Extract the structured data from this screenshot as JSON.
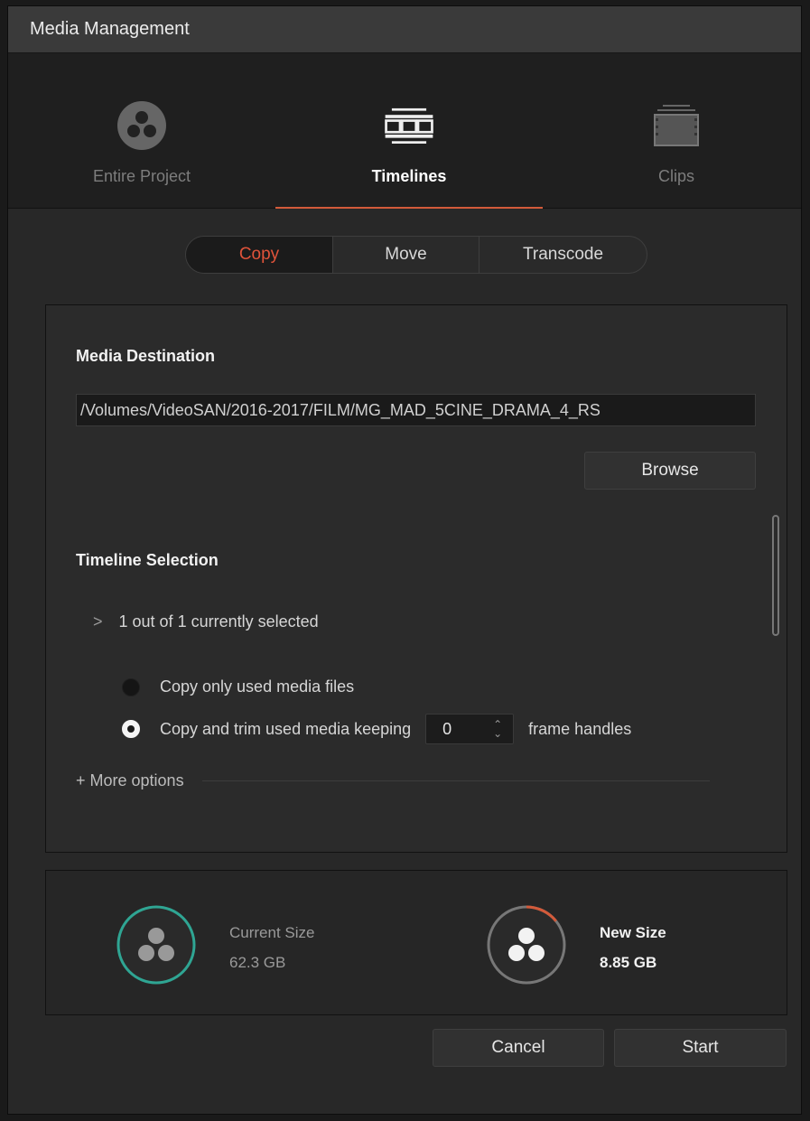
{
  "window": {
    "title": "Media Management"
  },
  "mode_tabs": [
    {
      "label": "Entire Project",
      "icon": "resolve-logo-icon",
      "active": false
    },
    {
      "label": "Timelines",
      "icon": "timeline-icon",
      "active": true
    },
    {
      "label": "Clips",
      "icon": "clip-film-icon",
      "active": false
    }
  ],
  "operation": {
    "options": [
      "Copy",
      "Move",
      "Transcode"
    ],
    "selected": "Copy"
  },
  "media_destination": {
    "title": "Media Destination",
    "path": "/Volumes/VideoSAN/2016-2017/FILM/MG_MAD_5CINE_DRAMA_4_RS",
    "browse_label": "Browse"
  },
  "timeline_selection": {
    "title": "Timeline Selection",
    "summary": "1 out of 1 currently selected",
    "option_used_only": "Copy only used media files",
    "option_trim": "Copy and trim used media keeping",
    "handles_value": "0",
    "handles_suffix": "frame handles",
    "selected_option": "trim",
    "more_options": "+ More options"
  },
  "sizes": {
    "current_label": "Current Size",
    "current_value": "62.3 GB",
    "new_label": "New Size",
    "new_value": "8.85 GB",
    "new_fraction_of_current": 0.142
  },
  "footer": {
    "cancel_label": "Cancel",
    "start_label": "Start"
  },
  "colors": {
    "accent": "#d35a3a",
    "teal": "#2fa593",
    "panel": "#2b2b2b"
  }
}
